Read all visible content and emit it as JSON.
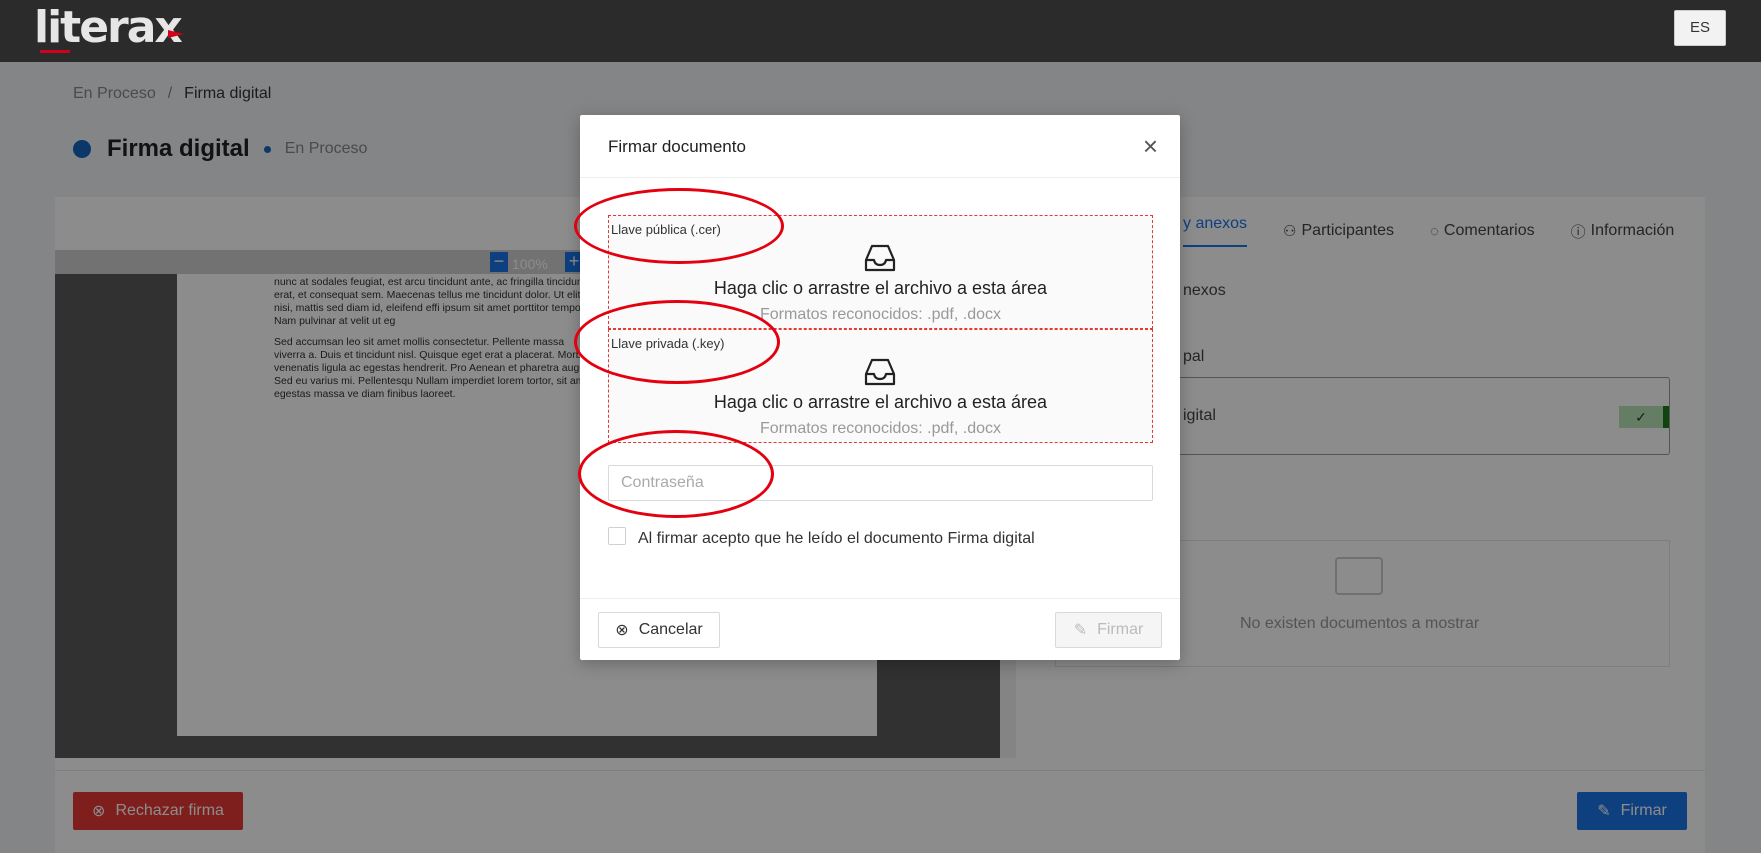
{
  "app": {
    "logo_text": "literax",
    "language_button": "ES"
  },
  "breadcrumb": {
    "parent": "En Proceso",
    "separator": "/",
    "current": "Firma digital"
  },
  "page": {
    "title": "Firma digital",
    "status": "En Proceso"
  },
  "viewer": {
    "zoom": "100%",
    "paragraph1": "nunc at sodales feugiat, est arcu tincidunt ante, ac fringilla tincidunt erat, et consequat sem. Maecenas tellus me tincidunt dolor. Ut elit nisi, mattis sed diam id, eleifend effi ipsum sit amet porttitor tempor. Nam pulvinar at velit ut eg",
    "paragraph2": "Sed accumsan leo sit amet mollis consectetur. Pellente massa viverra a. Duis et tincidunt nisl. Quisque eget erat a placerat. Morbi venenatis ligula ac egestas hendrerit. Pro Aenean et pharetra augue. Sed eu varius mi. Pellentesqu Nullam imperdiet lorem tortor, sit amet egestas massa ve diam finibus laoreet."
  },
  "side_panel": {
    "tabs": [
      {
        "label": "y anexos",
        "icon": "document-icon"
      },
      {
        "label": "Participantes",
        "icon": "users-icon"
      },
      {
        "label": "Comentarios",
        "icon": "comments-icon"
      },
      {
        "label": "Información",
        "icon": "info-icon"
      }
    ],
    "section_annexes": "nexos",
    "section_main": "pal",
    "doc_name": "igital",
    "empty_text": "No existen documentos a mostrar"
  },
  "footer": {
    "reject_label": "Rechazar firma",
    "sign_label": "Firmar"
  },
  "modal": {
    "title": "Firmar documento",
    "close_symbol": "×",
    "public_key": {
      "label": "Llave pública (.cer)",
      "main_text": "Haga clic o arrastre el archivo a esta área",
      "hint": "Formatos reconocidos: .pdf, .docx"
    },
    "private_key": {
      "label": "Llave privada (.key)",
      "main_text": "Haga clic o arrastre el archivo a esta área",
      "hint": "Formatos reconocidos: .pdf, .docx"
    },
    "password_placeholder": "Contraseña",
    "accept_text": "Al firmar acepto que he leído el documento Firma digital",
    "cancel_label": "Cancelar",
    "sign_label": "Firmar"
  },
  "colors": {
    "primary": "#1a73e8",
    "danger": "#e53935",
    "annotation": "#e3000f",
    "topbar": "#2b2b2b"
  }
}
